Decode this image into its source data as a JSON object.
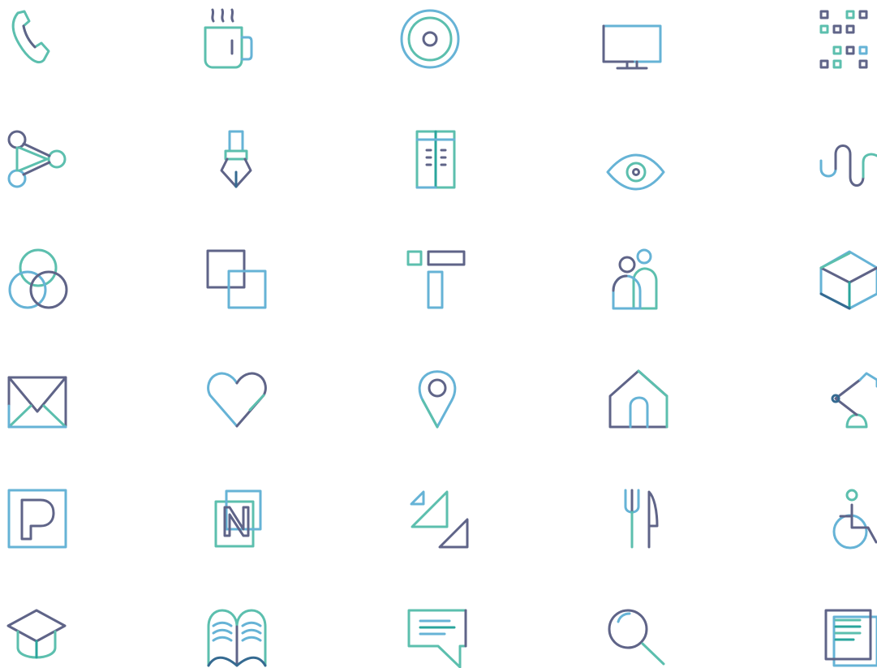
{
  "palette": {
    "background": "#ffffff",
    "navy": "#5f6488",
    "teal": "#5cbfae",
    "sky": "#66b3d6",
    "deep_teal": "#2aa59c",
    "dark_blue": "#356a91"
  },
  "icons": [
    [
      "phone-icon",
      "coffee-mug-icon",
      "target-icon",
      "monitor-icon",
      "qr-code-icon"
    ],
    [
      "share-network-icon",
      "pen-nib-icon",
      "book-spines-icon",
      "eye-icon",
      "wave-icon"
    ],
    [
      "color-circles-icon",
      "overlapping-squares-icon",
      "text-tool-icon",
      "people-icon",
      "cube-icon"
    ],
    [
      "envelope-icon",
      "heart-icon",
      "map-pin-icon",
      "home-icon",
      "desk-lamp-icon"
    ],
    [
      "parking-sign-icon",
      "n-badge-icon",
      "triangles-icon",
      "cutlery-icon",
      "wheelchair-icon"
    ],
    [
      "graduation-cap-icon",
      "open-book-icon",
      "chat-bubble-icon",
      "magnifier-icon",
      "document-icon"
    ]
  ]
}
